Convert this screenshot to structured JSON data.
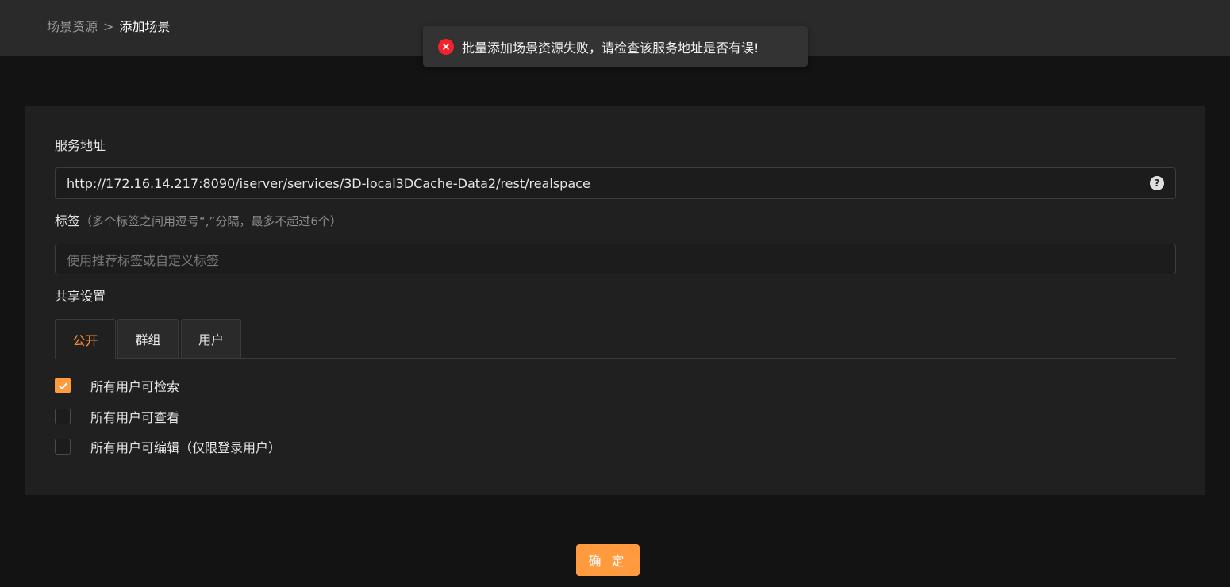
{
  "breadcrumb": {
    "parent": "场景资源",
    "separator": ">",
    "current": "添加场景"
  },
  "toast": {
    "type": "error",
    "icon": "error-circle-icon",
    "message": "批量添加场景资源失败，请检查该服务地址是否有误!"
  },
  "form": {
    "service_url": {
      "label": "服务地址",
      "value": "http://172.16.14.217:8090/iserver/services/3D-local3DCache-Data2/rest/realspace",
      "help_icon": "question-circle-icon"
    },
    "tags": {
      "label": "标签",
      "hint": "（多个标签之间用逗号“,”分隔，最多不超过6个）",
      "placeholder": "使用推荐标签或自定义标签"
    },
    "share": {
      "label": "共享设置",
      "tabs": [
        {
          "label": "公开",
          "active": true
        },
        {
          "label": "群组",
          "active": false
        },
        {
          "label": "用户",
          "active": false
        }
      ],
      "options": [
        {
          "label": "所有用户可检索",
          "checked": true
        },
        {
          "label": "所有用户可查看",
          "checked": false
        },
        {
          "label": "所有用户可编辑（仅限登录用户）",
          "checked": false
        }
      ]
    }
  },
  "confirm_label": "确 定",
  "colors": {
    "accent": "#ff9a3e",
    "error": "#f5222d",
    "background": "#131313",
    "panel": "#202020"
  }
}
